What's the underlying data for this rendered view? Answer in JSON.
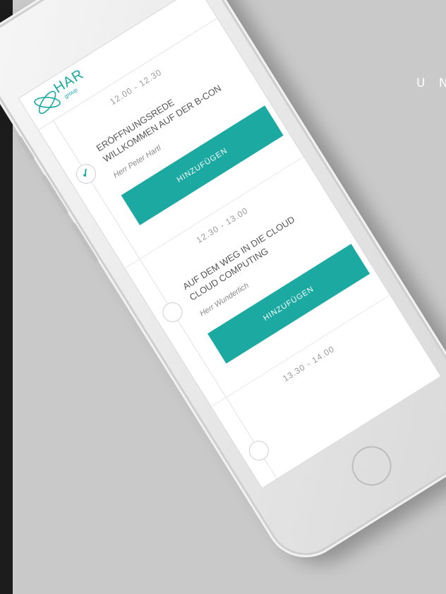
{
  "background_label": "U N",
  "colors": {
    "accent": "#1ba9a2",
    "background": "#c9c9c9"
  },
  "app": {
    "logo_text": "HAR",
    "logo_sub": "group"
  },
  "sessions": [
    {
      "time": "12.00 - 12.30",
      "title_line1": "ERÖFFNUNGSREDE",
      "title_line2": "WILLKOMMEN AUF DER B-CON",
      "speaker": "Herr Peter Hartl",
      "button_label": "HINZUFÜGEN",
      "checked": true,
      "check_icon": "✓"
    },
    {
      "time": "12.30 - 13.00",
      "title_line1": "AUF DEM WEG IN DIE CLOUD",
      "title_line2": "CLOUD COMPUTING",
      "speaker": "Herr Wunderlich",
      "button_label": "HINZUFÜGEN",
      "checked": false
    },
    {
      "time": "13.30 - 14.00",
      "checked": false
    }
  ]
}
